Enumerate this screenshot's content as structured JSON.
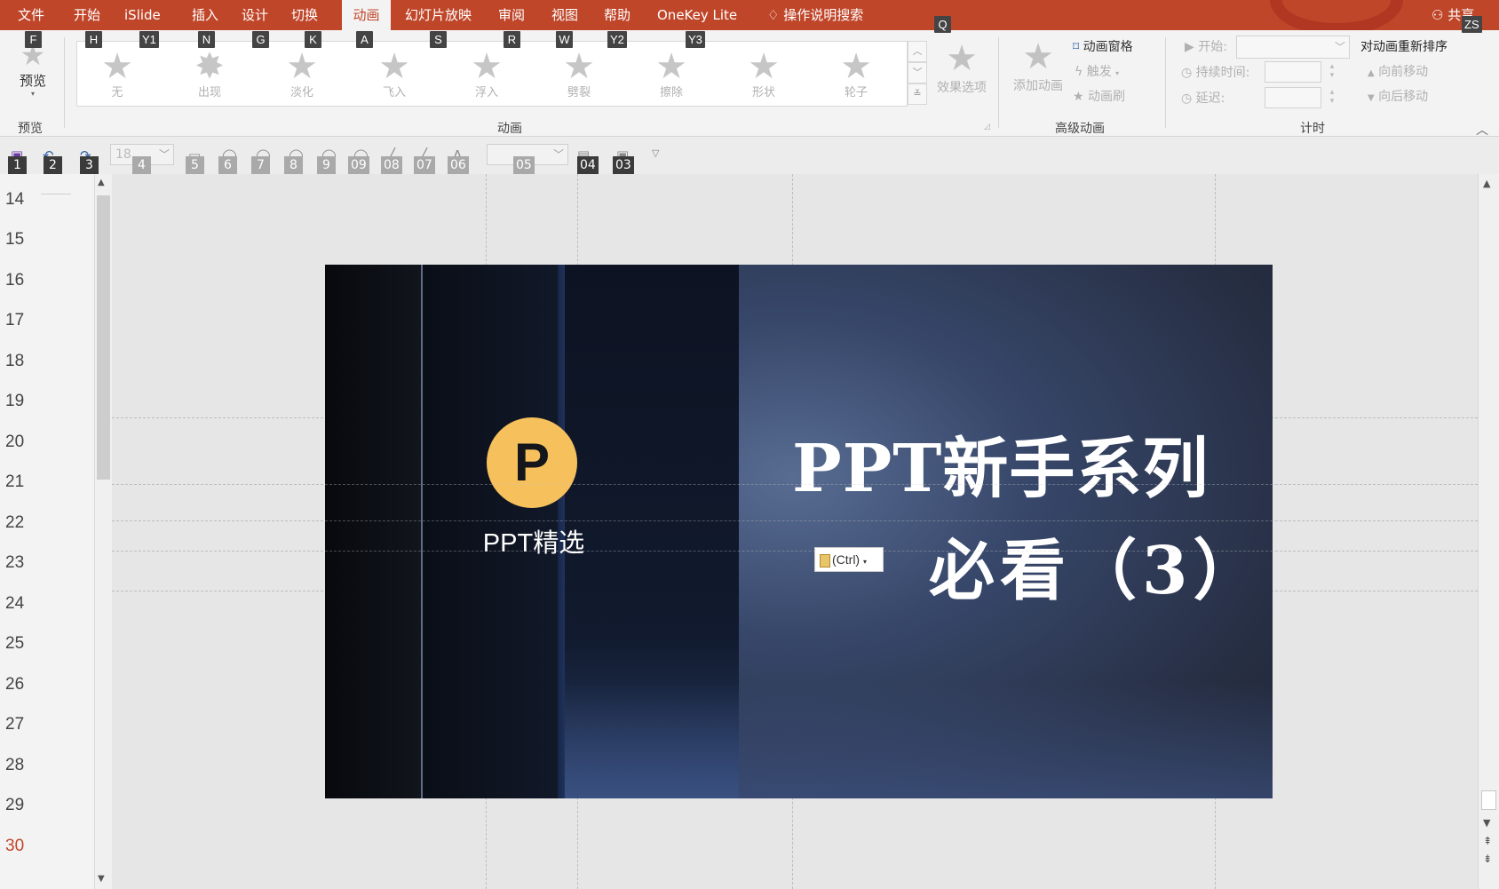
{
  "menu": {
    "items": [
      {
        "label": "文件",
        "keytip": "F"
      },
      {
        "label": "开始",
        "keytip": "H"
      },
      {
        "label": "iSlide",
        "keytip": "Y1"
      },
      {
        "label": "插入",
        "keytip": "N"
      },
      {
        "label": "设计",
        "keytip": "G"
      },
      {
        "label": "切换",
        "keytip": "K"
      },
      {
        "label": "动画",
        "keytip": "A"
      },
      {
        "label": "幻灯片放映",
        "keytip": "S"
      },
      {
        "label": "审阅",
        "keytip": "R"
      },
      {
        "label": "视图",
        "keytip": "W"
      },
      {
        "label": "帮助",
        "keytip": "Y2"
      },
      {
        "label": "OneKey Lite",
        "keytip": "Y3"
      }
    ],
    "active_tab": "动画",
    "search_label": "操作说明搜索",
    "search_keytip": "Q",
    "share_label": "共享",
    "share_keytip": "ZS"
  },
  "ribbon": {
    "preview": {
      "button": "预览",
      "group": "预览"
    },
    "animation_group": "动画",
    "animations": [
      "无",
      "出现",
      "淡化",
      "飞入",
      "浮入",
      "劈裂",
      "擦除",
      "形状",
      "轮子"
    ],
    "effect_options": "效果选项",
    "add_animation": "添加动画",
    "animation_pane": "动画窗格",
    "trigger": "触发",
    "animation_painter": "动画刷",
    "advanced_group": "高级动画",
    "start_label": "开始:",
    "duration_label": "持续时间:",
    "delay_label": "延迟:",
    "timing_group": "计时",
    "reorder_title": "对动画重新排序",
    "move_earlier": "向前移动",
    "move_later": "向后移动"
  },
  "qat": {
    "font_size": "18",
    "keytips": [
      "1",
      "2",
      "3",
      "4",
      "5",
      "6",
      "7",
      "8",
      "9",
      "09",
      "08",
      "07",
      "06",
      "05",
      "04",
      "03"
    ]
  },
  "outline": {
    "line_numbers": [
      "14",
      "15",
      "16",
      "17",
      "18",
      "19",
      "20",
      "21",
      "22",
      "23",
      "24",
      "25",
      "26",
      "27",
      "28",
      "29",
      "30"
    ],
    "current_line": "30"
  },
  "slide": {
    "logo_letter": "P",
    "logo_text": "PPT精选",
    "title": "PPT新手系列",
    "subtitle": "必看（3）",
    "paste_options_label": "(Ctrl)"
  },
  "colors": {
    "accent": "#c0462a",
    "logo_yellow": "#f6c15c"
  }
}
